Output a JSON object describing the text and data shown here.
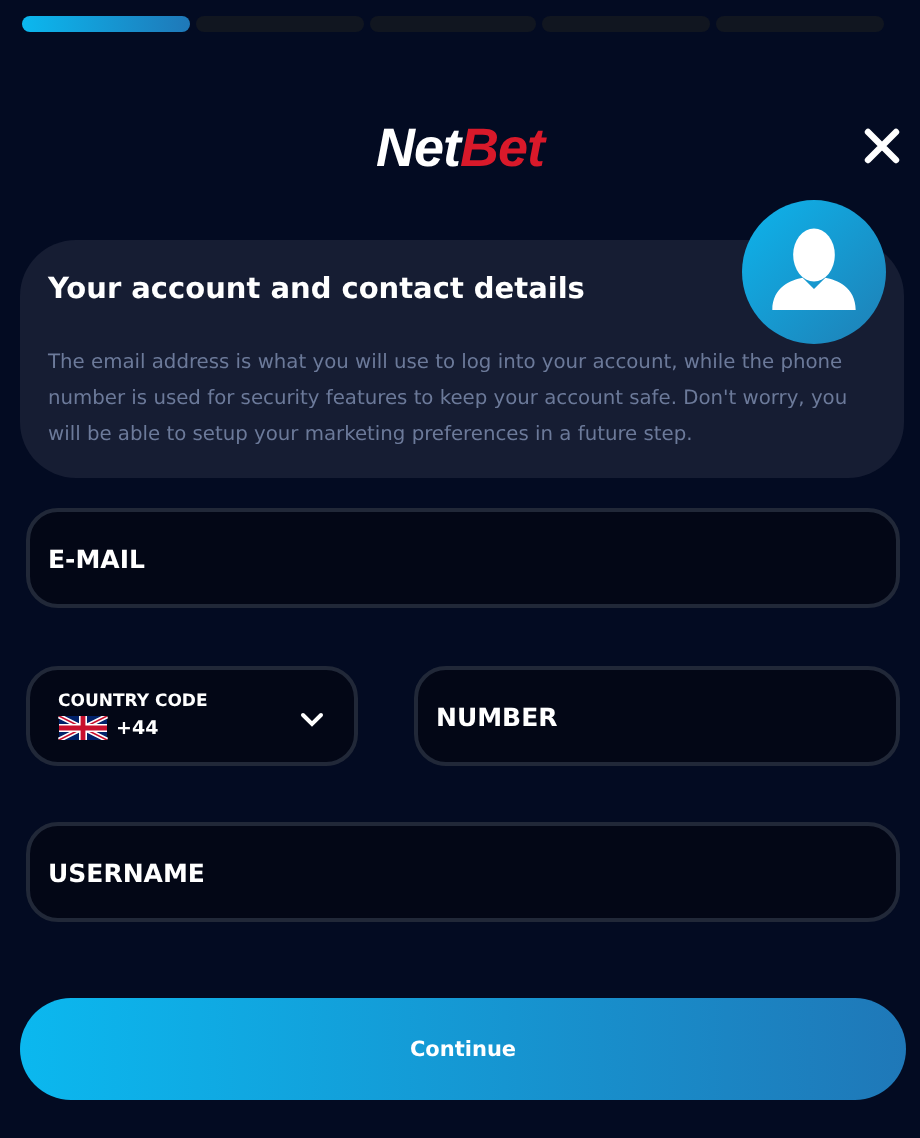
{
  "progress": [
    {
      "active": true
    },
    {
      "active": false
    },
    {
      "active": false
    },
    {
      "active": false
    },
    {
      "active": false
    }
  ],
  "logo": {
    "primary": "Net",
    "accent": "Bet"
  },
  "card": {
    "title": "Your account and contact details",
    "body": "The email address is what you will use to log into your account, while the phone number is used for security features to keep your account safe. Don't worry, you will be able to setup your marketing preferences in a future step."
  },
  "email": {
    "placeholder": "E-MAIL"
  },
  "country_code": {
    "label": "COUNTRY CODE",
    "value": "+44"
  },
  "number": {
    "placeholder": "NUMBER"
  },
  "username": {
    "placeholder": "USERNAME"
  },
  "continue_button": "Continue"
}
